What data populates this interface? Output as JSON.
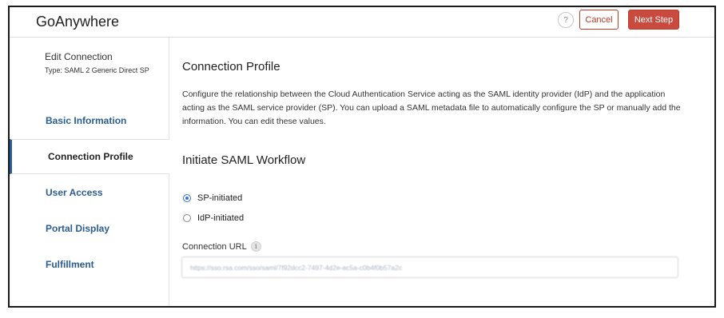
{
  "header": {
    "app_title": "GoAnywhere",
    "help_label": "?",
    "cancel_label": "Cancel",
    "next_label": "Next Step",
    "accent_color": "#c94a3e"
  },
  "sidebar": {
    "heading": "Edit Connection",
    "type_label": "Type: SAML 2 Generic Direct SP",
    "items": [
      {
        "label": "Basic Information",
        "active": false
      },
      {
        "label": "Connection Profile",
        "active": true
      },
      {
        "label": "User Access",
        "active": false
      },
      {
        "label": "Portal Display",
        "active": false
      },
      {
        "label": "Fulfillment",
        "active": false
      }
    ],
    "link_color": "#2a5d94"
  },
  "main": {
    "title": "Connection Profile",
    "description": "Configure the relationship between the Cloud Authentication Service acting as the SAML identity provider (IdP) and the application acting as the SAML service provider (SP). You can upload a SAML metadata file to automatically configure the SP or manually add the information. You can edit these values.",
    "workflow_title": "Initiate SAML Workflow",
    "workflow_options": [
      {
        "label": "SP-initiated",
        "selected": true
      },
      {
        "label": "IdP-initiated",
        "selected": false
      }
    ],
    "connection_url": {
      "label": "Connection URL",
      "info_icon": "info-icon",
      "value": "https://sso.rsa.com/sso/saml/7f92dcc2-7497-4d2e-ac5a-c0b4f0b57a2c"
    }
  }
}
